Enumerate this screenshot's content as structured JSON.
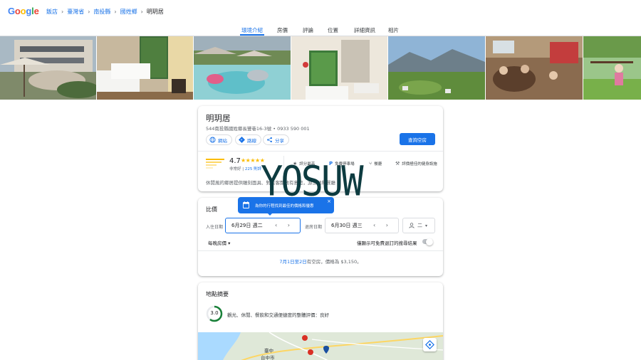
{
  "logo": {
    "letters": [
      {
        "ch": "G",
        "color": "#4285F4"
      },
      {
        "ch": "o",
        "color": "#EA4335"
      },
      {
        "ch": "o",
        "color": "#FBBC05"
      },
      {
        "ch": "g",
        "color": "#4285F4"
      },
      {
        "ch": "l",
        "color": "#34A853"
      },
      {
        "ch": "e",
        "color": "#EA4335"
      }
    ]
  },
  "breadcrumb": [
    "飯店",
    "臺灣省",
    "南投縣",
    "國姓鄉",
    "明玥居"
  ],
  "tabs": [
    "環境介紹",
    "房價",
    "評論",
    "位置",
    "詳細資訊",
    "相片"
  ],
  "hotel": {
    "name": "明玥居",
    "address": "544南投縣國姓鄉長豐巷16-3號 • 0933 590 001",
    "actions": {
      "website": "網站",
      "directions": "路線",
      "share": "分享"
    },
    "check_button": "查詢空房",
    "rating": {
      "score": "4.7",
      "stars": "★★★★★",
      "label": "非常好",
      "reviews": "225 則評"
    },
    "amenities": [
      "評分最高",
      "免費停車場",
      "餐廳",
      "評價極佳的健身設施"
    ],
    "description": "休閒風的鄉居提供雕刻面具、對住客開放有意思，游泳池和餐廳"
  },
  "watermark": "YOSUW",
  "pricing": {
    "title": "比價",
    "tooltip": "為你的行程找到最佳的價格和優惠",
    "tooltip_close": "×",
    "checkin_label": "入住日期",
    "checkin_value": "6月29日 週二",
    "checkout_label": "退房日期",
    "checkout_value": "6月30日 週三",
    "guests_value": "二",
    "nav_arrows": "‹ ›",
    "nightly": "每晚房價 ▾",
    "toggle_label": "僅顯示可免費退訂的搜尋結果",
    "availability_date": "7月1日至2日",
    "availability_text": "有空房，價格為 $3,150。"
  },
  "location": {
    "title": "地點摘要",
    "score": "3.0",
    "summary": "觀光、休閒、餐飲和交通便捷度的整體評價：良好",
    "map_labels": [
      "臺中",
      "台中市"
    ]
  },
  "colors": {
    "accent": "#1a73e8",
    "star": "#fbbc04",
    "score_ring": "#188038"
  }
}
